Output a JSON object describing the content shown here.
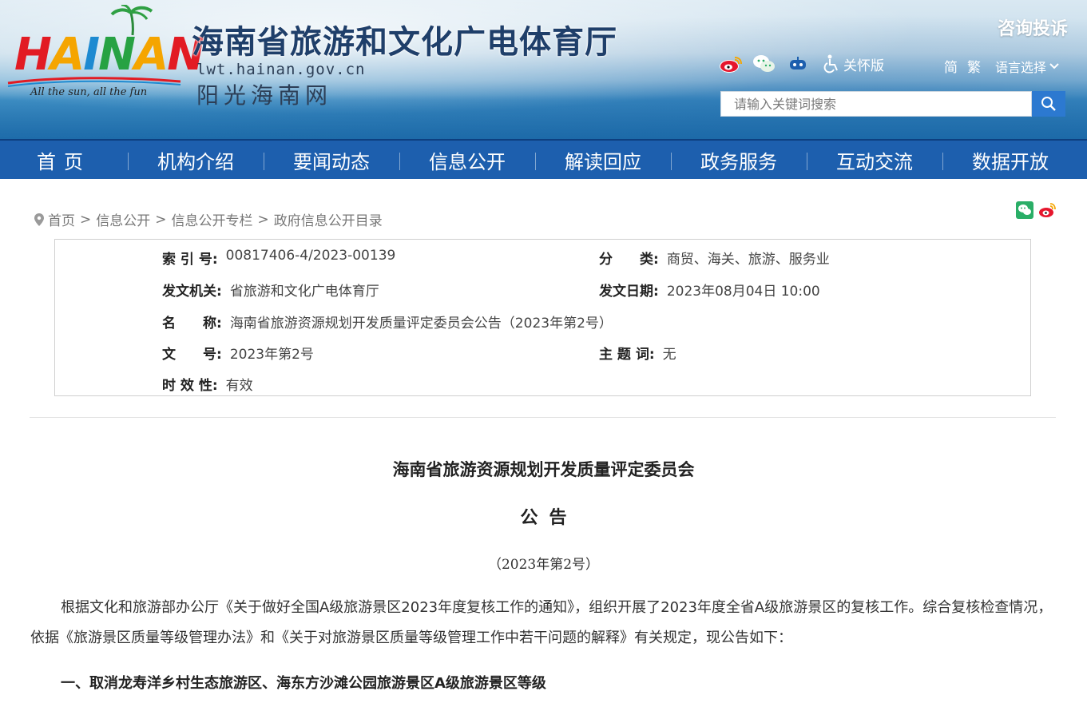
{
  "header": {
    "logo_word": "HAINAN",
    "logo_slogan": "All the sun, all the fun",
    "site_title": "海南省旅游和文化广电体育厅",
    "site_domain": "lwt.hainan.gov.cn",
    "site_sub": "阳光海南网",
    "complaint": "咨询投诉",
    "care_label": "关怀版",
    "lang_simplified": "简",
    "lang_traditional": "繁",
    "lang_select": "语言选择",
    "search_placeholder": "请输入关键词搜索",
    "icons": [
      "weibo-icon",
      "wechat-icon",
      "robot-icon",
      "accessibility-icon",
      "search-icon"
    ]
  },
  "nav": {
    "items": [
      "首页",
      "机构介绍",
      "要闻动态",
      "信息公开",
      "解读回应",
      "政务服务",
      "互动交流",
      "数据开放"
    ]
  },
  "breadcrumb": {
    "items": [
      "首页",
      "信息公开",
      "信息公开专栏",
      "政府信息公开目录"
    ],
    "separator": ">"
  },
  "meta": {
    "index_label": "索 引 号:",
    "index_value": "00817406-4/2023-00139",
    "category_label": "分　　类:",
    "category_value": "商贸、海关、旅游、服务业",
    "issuer_label": "发文机关:",
    "issuer_value": "省旅游和文化广电体育厅",
    "date_label": "发文日期:",
    "date_value": "2023年08月04日 10:00",
    "name_label": "名　　称:",
    "name_value": "海南省旅游资源规划开发质量评定委员会公告（2023年第2号）",
    "doc_no_label": "文　　号:",
    "doc_no_value": "2023年第2号",
    "subject_label": "主 题 词:",
    "subject_value": "无",
    "validity_label": "时 效 性:",
    "validity_value": "有效"
  },
  "article": {
    "title1": "海南省旅游资源规划开发质量评定委员会",
    "title2": "公告",
    "number": "（2023年第2号）",
    "paragraph": "根据文化和旅游部办公厅《关于做好全国A级旅游景区2023年度复核工作的通知》，组织开展了2023年度全省A级旅游景区的复核工作。综合复核检查情况，依据《旅游景区质量等级管理办法》和《关于对旅游景区质量等级管理工作中若干问题的解释》有关规定，现公告如下：",
    "section1": "一、取消龙寿洋乡村生态旅游区、海东方沙滩公园旅游景区A级旅游景区等级"
  },
  "colors": {
    "nav_bg": "#1d5fae",
    "search_btn": "#2c79d0"
  }
}
